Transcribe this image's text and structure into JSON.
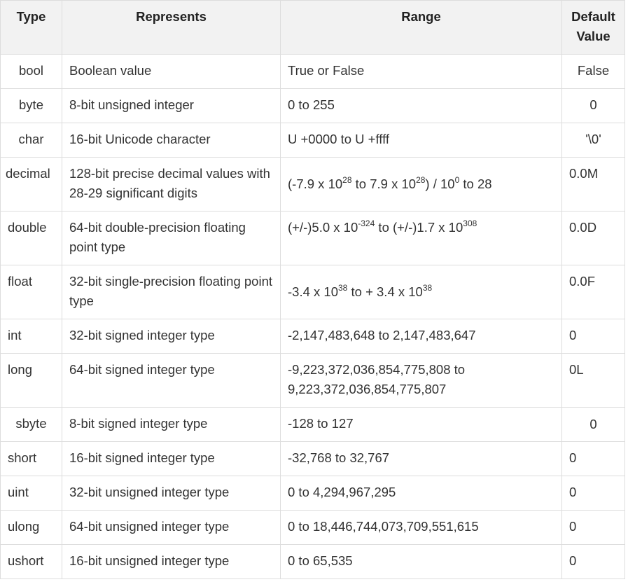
{
  "table": {
    "headers": [
      "Type",
      "Represents",
      "Range",
      "Default Value"
    ],
    "header_default_line1": "Default",
    "header_default_line2": "Value",
    "rows": [
      {
        "type": "bool",
        "represents": "Boolean value",
        "range": "True or False",
        "default": "False"
      },
      {
        "type": "byte",
        "represents": "8-bit unsigned integer",
        "range": "0 to 255",
        "default": "0"
      },
      {
        "type": "char",
        "represents": "16-bit Unicode character",
        "range": "U +0000 to U +ffff",
        "default": "'\\0'"
      },
      {
        "type": "decimal",
        "represents": "128-bit precise decimal values with 28-29 significant digits",
        "range_parts": {
          "a": "(-7.9 x 10",
          "a_exp": "28",
          "b": " to 7.9 x 10",
          "b_exp": "28",
          "c": ") / 10",
          "c_exp": "0",
          "d": " to 28"
        },
        "default": "0.0M"
      },
      {
        "type": "double",
        "represents": "64-bit double-precision floating point type",
        "range_parts": {
          "a": "(+/-)5.0 x 10",
          "a_exp": "-324",
          "b": " to (+/-)1.7 x 10",
          "b_exp": "308"
        },
        "default": "0.0D"
      },
      {
        "type": "float",
        "represents": "32-bit single-precision floating point type",
        "range_parts": {
          "a": "-3.4 x 10",
          "a_exp": "38",
          "b": " to + 3.4 x 10",
          "b_exp": "38"
        },
        "default": "0.0F"
      },
      {
        "type": "int",
        "represents": "32-bit signed integer type",
        "range": "-2,147,483,648 to 2,147,483,647",
        "default": "0"
      },
      {
        "type": "long",
        "represents": "64-bit signed integer type",
        "range": "-9,223,372,036,854,775,808 to 9,223,372,036,854,775,807",
        "default": "0L"
      },
      {
        "type": "sbyte",
        "represents": "8-bit signed integer type",
        "range": "-128 to 127",
        "default": "0"
      },
      {
        "type": "short",
        "represents": "16-bit signed integer type",
        "range": "-32,768 to 32,767",
        "default": "0"
      },
      {
        "type": "uint",
        "represents": "32-bit unsigned integer type",
        "range": "0 to 4,294,967,295",
        "default": "0"
      },
      {
        "type": "ulong",
        "represents": "64-bit unsigned integer type",
        "range": "0 to 18,446,744,073,709,551,615",
        "default": "0"
      },
      {
        "type": "ushort",
        "represents": "16-bit unsigned integer type",
        "range": "0 to 65,535",
        "default": "0"
      }
    ]
  }
}
